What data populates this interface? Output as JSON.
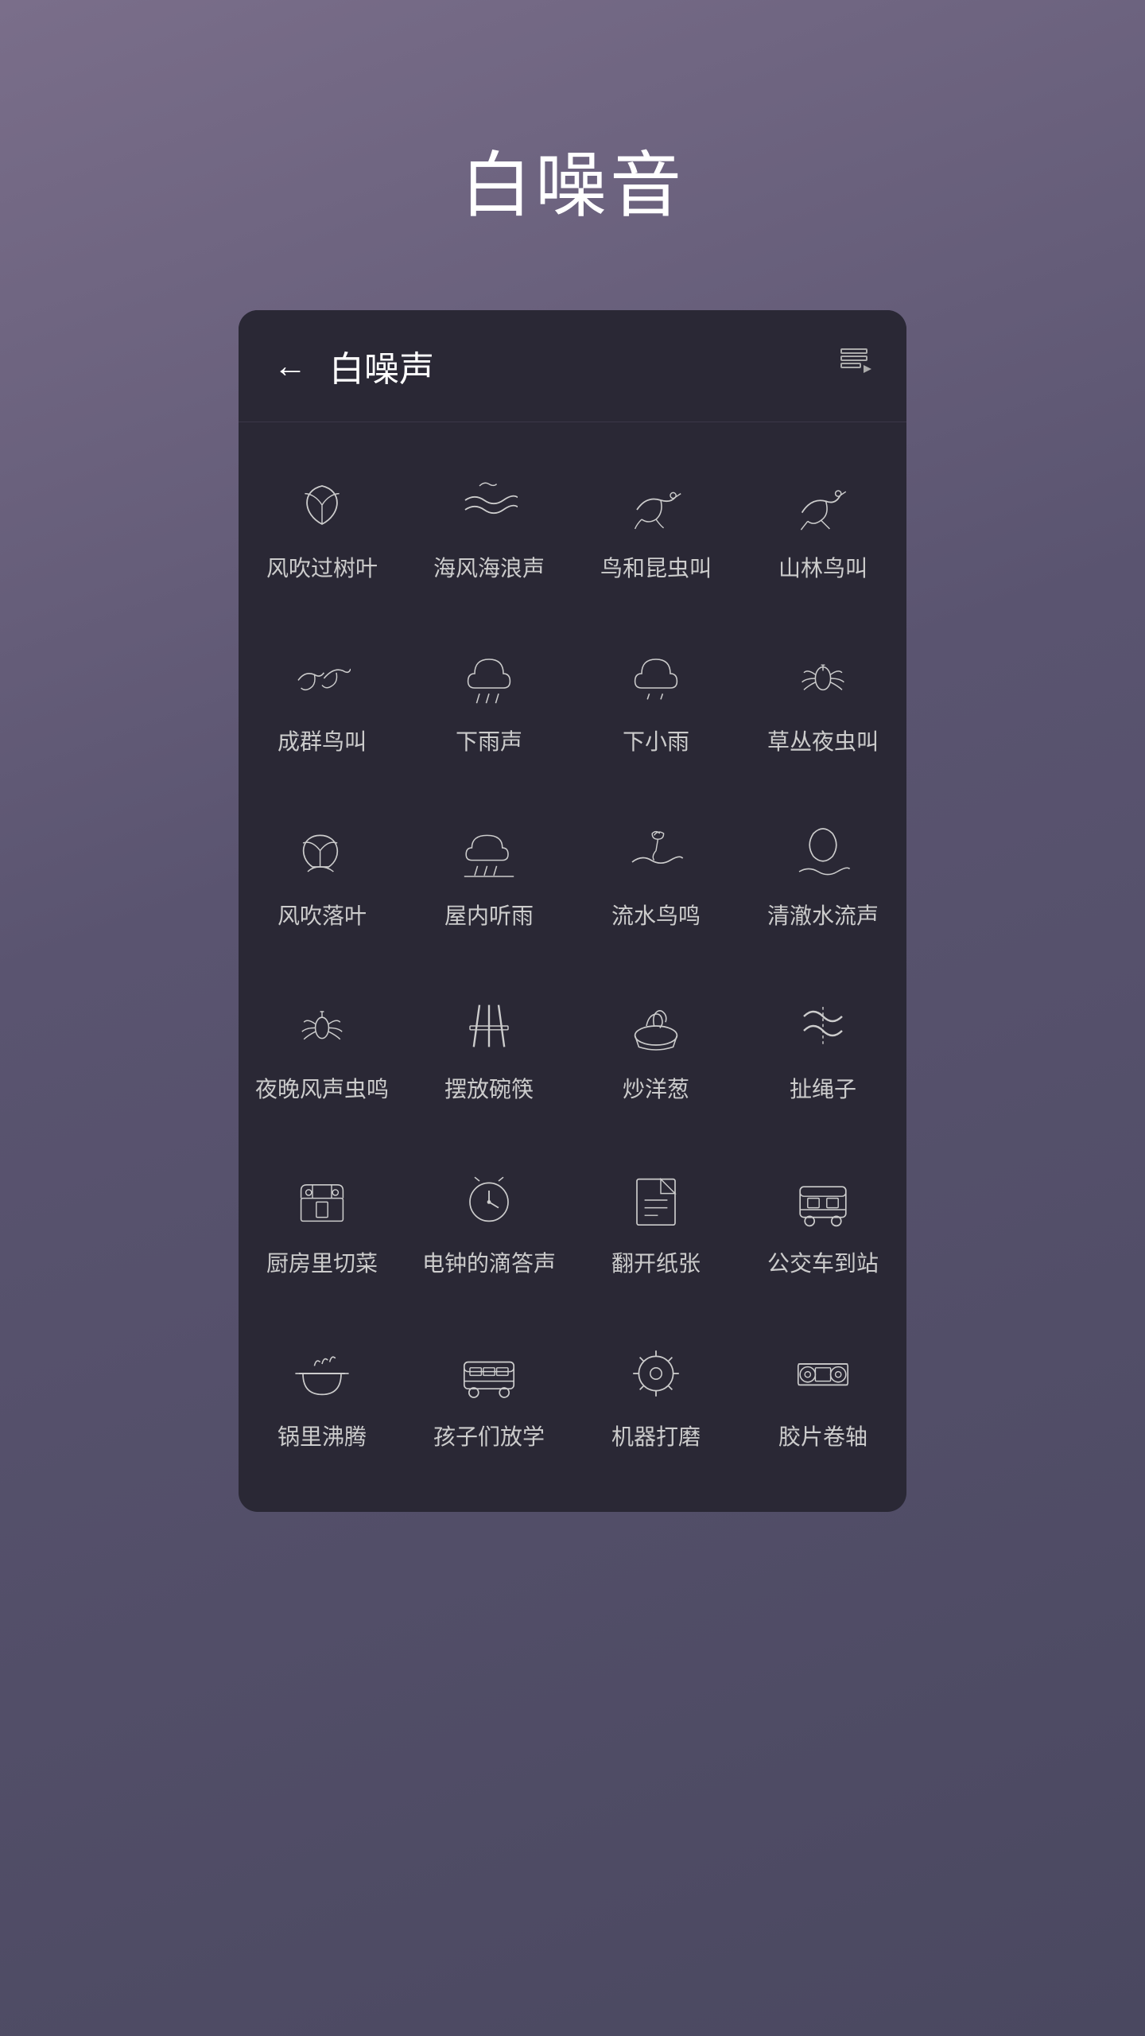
{
  "pageTitle": "白噪音",
  "header": {
    "title": "白噪声",
    "back": "←",
    "playlistIcon": "playlist"
  },
  "items": [
    {
      "id": "wind-leaves",
      "label": "风吹过树叶",
      "icon": "leaf"
    },
    {
      "id": "sea-waves",
      "label": "海风海浪声",
      "icon": "waves"
    },
    {
      "id": "birds-insects",
      "label": "鸟和昆虫叫",
      "icon": "bird"
    },
    {
      "id": "forest-birds",
      "label": "山林鸟叫",
      "icon": "bird2"
    },
    {
      "id": "flock-birds",
      "label": "成群鸟叫",
      "icon": "bird3"
    },
    {
      "id": "rain",
      "label": "下雨声",
      "icon": "rain"
    },
    {
      "id": "light-rain",
      "label": "下小雨",
      "icon": "lightrain"
    },
    {
      "id": "night-insects",
      "label": "草丛夜虫叫",
      "icon": "insects"
    },
    {
      "id": "fallen-leaves",
      "label": "风吹落叶",
      "icon": "fallenleaf"
    },
    {
      "id": "indoor-rain",
      "label": "屋内听雨",
      "icon": "indoorrain"
    },
    {
      "id": "stream-birds",
      "label": "流水鸟鸣",
      "icon": "stream"
    },
    {
      "id": "clear-water",
      "label": "清澈水流声",
      "icon": "clearwater"
    },
    {
      "id": "night-wind-insects",
      "label": "夜晚风声虫鸣",
      "icon": "nightinsects"
    },
    {
      "id": "bowls-chopsticks",
      "label": "摆放碗筷",
      "icon": "chopsticks"
    },
    {
      "id": "fry-onions",
      "label": "炒洋葱",
      "icon": "fryonions"
    },
    {
      "id": "skipping-rope",
      "label": "扯绳子",
      "icon": "rope"
    },
    {
      "id": "kitchen-cutting",
      "label": "厨房里切菜",
      "icon": "kitchen"
    },
    {
      "id": "clock-tick",
      "label": "电钟的滴答声",
      "icon": "clock"
    },
    {
      "id": "flip-paper",
      "label": "翻开纸张",
      "icon": "paper"
    },
    {
      "id": "bus-stop",
      "label": "公交车到站",
      "icon": "bus"
    },
    {
      "id": "boiling-pot",
      "label": "锅里沸腾",
      "icon": "pot"
    },
    {
      "id": "school-out",
      "label": "孩子们放学",
      "icon": "schoolbus"
    },
    {
      "id": "machine-grind",
      "label": "机器打磨",
      "icon": "grinder"
    },
    {
      "id": "film-reel",
      "label": "胶片卷轴",
      "icon": "filmreel"
    }
  ]
}
